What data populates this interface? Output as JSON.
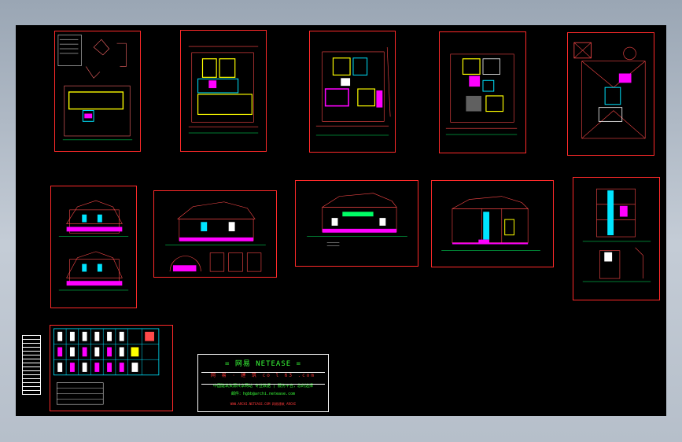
{
  "drawing": {
    "background": "#000000",
    "sheet_border_color": "#ff2a2a",
    "sheets": [
      "site-plan-sheet",
      "ground-floor-plan-sheet",
      "first-floor-plan-sheet",
      "second-floor-plan-sheet",
      "roof-plan-sheet",
      "elevations-sheet-1",
      "elevations-sheet-2",
      "elevations-sheet-3",
      "elevations-sheet-4",
      "section-sheet",
      "door-window-schedule-sheet"
    ]
  },
  "title_block": {
    "brand": "= 网易 NETEASE =",
    "site": "网 易 · 建 筑  co l 63 .com",
    "description": "中国建筑资源共享网站 专业数据 | 服务平台，您的选择",
    "email": "邮件：hgbb@archi.netease.com",
    "footer": "WWW.ARCHI.NETEASE.COM  网易建筑 ARCHI"
  }
}
